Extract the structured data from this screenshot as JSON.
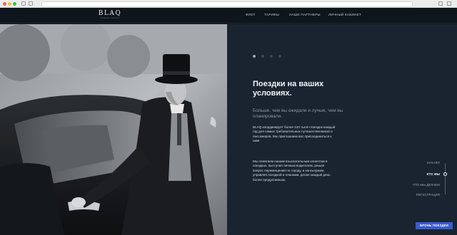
{
  "brand": {
    "name": "BLAQ",
    "tagline": "premium service"
  },
  "nav": {
    "items": [
      "ФЛОТ",
      "ТАРИФЫ",
      "НАШИ ПАРТНЕРЫ",
      "ЛИЧНЫЙ КАБИНЕТ"
    ]
  },
  "hero": {
    "title": "Поездки на ваших условиях.",
    "subtitle": "Больше, чем вы ожидали и лучше, чем вы планировали.",
    "paragraph1": "BLAQ координирует более 120 тысяч поездок каждый год для самых требовательных путешественников и пассажиров. Мы приглашаем вас присоединиться к ним!",
    "paragraph2": "Мы помогаем нашим взыскательным клиентам в поездках, выступая личным водителем, решая вопрос перемещений по городу, и консьержем, управляя поездкой и планами, делая каждый день более продуктивным."
  },
  "slider": {
    "total": 4,
    "active": 1
  },
  "side_nav": {
    "items": [
      "НАЧАЛО",
      "КТО МЫ",
      "ЧТО МЫ ДЕЛАЕМ",
      "РЕГИСТРАЦИЯ"
    ],
    "active": "КТО МЫ"
  },
  "cta": {
    "label": "БРОНЬ ПОЕЗДКИ"
  },
  "colors": {
    "accent": "#3a5bd1",
    "panel": "#1a2431",
    "header": "#0f151c"
  }
}
